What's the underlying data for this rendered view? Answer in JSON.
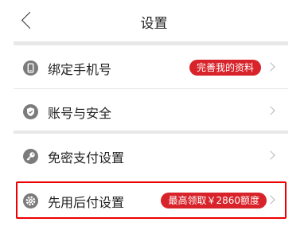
{
  "header": {
    "title": "设置"
  },
  "items": [
    {
      "label": "绑定手机号",
      "icon": "phone-icon",
      "badge": "完善我的资料"
    },
    {
      "label": "账号与安全",
      "icon": "shield-icon"
    },
    {
      "label": "免密支付设置",
      "icon": "key-icon"
    },
    {
      "label": "先用后付设置",
      "icon": "gear-icon",
      "badge": "最高领取￥2860额度"
    }
  ],
  "colors": {
    "accent": "#d8232a",
    "icon": "#7b7b7b",
    "separator": "#e8e8e8"
  }
}
